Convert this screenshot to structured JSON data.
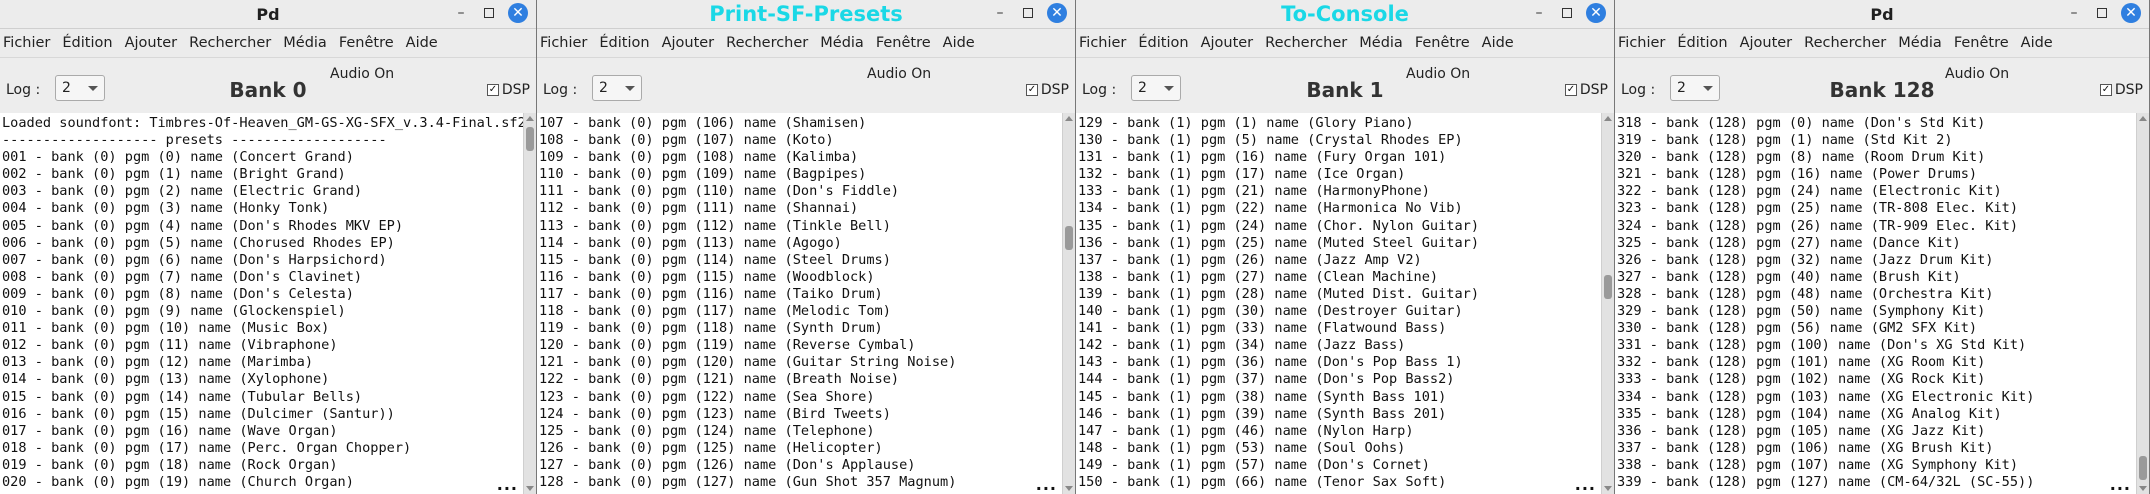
{
  "menu": [
    "Fichier",
    "Édition",
    "Ajouter",
    "Rechercher",
    "Média",
    "Fenêtre",
    "Aide"
  ],
  "colors": {
    "title_accent": "#1ad8e6",
    "close_button": "#2f7fe0"
  },
  "windows": [
    {
      "title": "Pd",
      "log_label": "Log :",
      "log_value": "2",
      "bank_label": "Bank 0",
      "audio_status": "Audio On",
      "dsp_label": "DSP",
      "ellipsis": "...",
      "lines": [
        "Loaded soundfont: Timbres-Of-Heaven_GM-GS-XG-SFX_v.3.4-Final.sf2",
        "------------------- presets -------------------",
        "001 - bank (0) pgm (0) name (Concert Grand)",
        "002 - bank (0) pgm (1) name (Bright Grand)",
        "003 - bank (0) pgm (2) name (Electric Grand)",
        "004 - bank (0) pgm (3) name (Honky Tonk)",
        "005 - bank (0) pgm (4) name (Don's Rhodes MKV EP)",
        "006 - bank (0) pgm (5) name (Chorused Rhodes EP)",
        "007 - bank (0) pgm (6) name (Don's Harpsichord)",
        "008 - bank (0) pgm (7) name (Don's Clavinet)",
        "009 - bank (0) pgm (8) name (Don's Celesta)",
        "010 - bank (0) pgm (9) name (Glockenspiel)",
        "011 - bank (0) pgm (10) name (Music Box)",
        "012 - bank (0) pgm (11) name (Vibraphone)",
        "013 - bank (0) pgm (12) name (Marimba)",
        "014 - bank (0) pgm (13) name (Xylophone)",
        "015 - bank (0) pgm (14) name (Tubular Bells)",
        "016 - bank (0) pgm (15) name (Dulcimer (Santur))",
        "017 - bank (0) pgm (16) name (Wave Organ)",
        "018 - bank (0) pgm (17) name (Perc. Organ Chopper)",
        "019 - bank (0) pgm (18) name (Rock Organ)",
        "020 - bank (0) pgm (19) name (Church Organ)"
      ],
      "scroll_position": 0.0
    },
    {
      "title": "Print-SF-Presets",
      "log_label": "Log :",
      "log_value": "2",
      "bank_label": "",
      "audio_status": "Audio On",
      "dsp_label": "DSP",
      "ellipsis": "...",
      "lines": [
        "107 - bank (0) pgm (106) name (Shamisen)",
        "108 - bank (0) pgm (107) name (Koto)",
        "109 - bank (0) pgm (108) name (Kalimba)",
        "110 - bank (0) pgm (109) name (Bagpipes)",
        "111 - bank (0) pgm (110) name (Don's Fiddle)",
        "112 - bank (0) pgm (111) name (Shannai)",
        "113 - bank (0) pgm (112) name (Tinkle Bell)",
        "114 - bank (0) pgm (113) name (Agogo)",
        "115 - bank (0) pgm (114) name (Steel Drums)",
        "116 - bank (0) pgm (115) name (Woodblock)",
        "117 - bank (0) pgm (116) name (Taiko Drum)",
        "118 - bank (0) pgm (117) name (Melodic Tom)",
        "119 - bank (0) pgm (118) name (Synth Drum)",
        "120 - bank (0) pgm (119) name (Reverse Cymbal)",
        "121 - bank (0) pgm (120) name (Guitar String Noise)",
        "122 - bank (0) pgm (121) name (Breath Noise)",
        "123 - bank (0) pgm (122) name (Sea Shore)",
        "124 - bank (0) pgm (123) name (Bird Tweets)",
        "125 - bank (0) pgm (124) name (Telephone)",
        "126 - bank (0) pgm (125) name (Helicopter)",
        "127 - bank (0) pgm (126) name (Don's Applause)",
        "128 - bank (0) pgm (127) name (Gun Shot 357 Magnum)"
      ],
      "scroll_position": 0.3
    },
    {
      "title": "To-Console",
      "log_label": "Log :",
      "log_value": "2",
      "bank_label": "Bank 1",
      "audio_status": "Audio On",
      "dsp_label": "DSP",
      "ellipsis": "...",
      "lines": [
        "129 - bank (1) pgm (1) name (Glory Piano)",
        "130 - bank (1) pgm (5) name (Crystal Rhodes EP)",
        "131 - bank (1) pgm (16) name (Fury Organ 101)",
        "132 - bank (1) pgm (17) name (Ice Organ)",
        "133 - bank (1) pgm (21) name (HarmonyPhone)",
        "134 - bank (1) pgm (22) name (Harmonica No Vib)",
        "135 - bank (1) pgm (24) name (Chor. Nylon Guitar)",
        "136 - bank (1) pgm (25) name (Muted Steel Guitar)",
        "137 - bank (1) pgm (26) name (Jazz Amp V2)",
        "138 - bank (1) pgm (27) name (Clean Machine)",
        "139 - bank (1) pgm (28) name (Muted Dist. Guitar)",
        "140 - bank (1) pgm (30) name (Destroyer Guitar)",
        "141 - bank (1) pgm (33) name (Flatwound Bass)",
        "142 - bank (1) pgm (34) name (Jazz Bass)",
        "143 - bank (1) pgm (36) name (Don's Pop Bass 1)",
        "144 - bank (1) pgm (37) name (Don's Pop Bass2)",
        "145 - bank (1) pgm (38) name (Synth Bass 101)",
        "146 - bank (1) pgm (39) name (Synth Bass 201)",
        "147 - bank (1) pgm (46) name (Nylon Harp)",
        "148 - bank (1) pgm (53) name (Soul Oohs)",
        "149 - bank (1) pgm (57) name (Don's Cornet)",
        "150 - bank (1) pgm (66) name (Tenor Sax Soft)"
      ],
      "scroll_position": 0.45
    },
    {
      "title": "Pd",
      "log_label": "Log :",
      "log_value": "2",
      "bank_label": "Bank 128",
      "audio_status": "Audio On",
      "dsp_label": "DSP",
      "ellipsis": "...",
      "lines": [
        "318 - bank (128) pgm (0) name (Don's Std Kit)",
        "319 - bank (128) pgm (1) name (Std Kit 2)",
        "320 - bank (128) pgm (8) name (Room Drum Kit)",
        "321 - bank (128) pgm (16) name (Power Drums)",
        "322 - bank (128) pgm (24) name (Electronic Kit)",
        "323 - bank (128) pgm (25) name (TR-808 Elec. Kit)",
        "324 - bank (128) pgm (26) name (TR-909 Elec. Kit)",
        "325 - bank (128) pgm (27) name (Dance Kit)",
        "326 - bank (128) pgm (32) name (Jazz Drum Kit)",
        "327 - bank (128) pgm (40) name (Brush Kit)",
        "328 - bank (128) pgm (48) name (Orchestra Kit)",
        "329 - bank (128) pgm (50) name (Symphony Kit)",
        "330 - bank (128) pgm (56) name (GM2 SFX Kit)",
        "331 - bank (128) pgm (100) name (Don's XG Std Kit)",
        "332 - bank (128) pgm (101) name (XG Room Kit)",
        "333 - bank (128) pgm (102) name (XG Rock Kit)",
        "334 - bank (128) pgm (103) name (XG Electronic Kit)",
        "335 - bank (128) pgm (104) name (XG Analog Kit)",
        "336 - bank (128) pgm (105) name (XG Jazz Kit)",
        "337 - bank (128) pgm (106) name (XG Brush Kit)",
        "338 - bank (128) pgm (107) name (XG Symphony Kit)",
        "339 - bank (128) pgm (127) name (CM-64/32L (SC-55))"
      ],
      "scroll_position": 1.0
    }
  ]
}
